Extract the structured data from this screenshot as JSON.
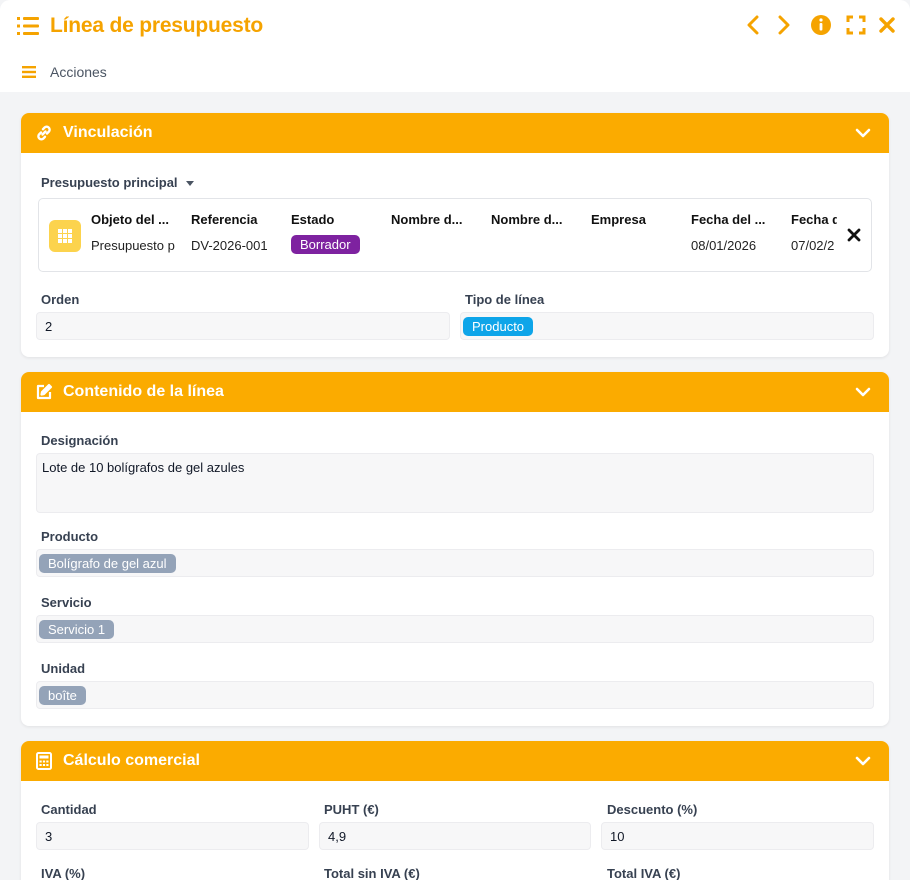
{
  "window": {
    "title": "Línea de presupuesto",
    "actions_label": "Acciones"
  },
  "colors": {
    "accent": "#fbab00",
    "title": "#f5a300",
    "chip_blue": "#0ea5e9",
    "chip_grey": "#94a3b8",
    "chip_purple": "#7e22a0"
  },
  "icons": {
    "title": "list-menu-icon",
    "prev": "chevron-left-icon",
    "next": "chevron-right-icon",
    "info": "info-icon",
    "fullscreen": "fullscreen-icon",
    "close": "close-icon",
    "vinculacion": "link-icon",
    "contenido": "edit-icon",
    "calculo": "calculator-icon"
  },
  "vinculacion": {
    "title": "Vinculación",
    "parent_label": "Presupuesto principal",
    "columns": [
      "Objeto del ...",
      "Referencia",
      "Estado",
      "Nombre d...",
      "Nombre d...",
      "Empresa",
      "Fecha del ...",
      "Fecha d"
    ],
    "row": {
      "objeto": "Presupuesto p",
      "referencia": "DV-2026-001",
      "estado": "Borrador",
      "fecha1": "08/01/2026",
      "fecha2": "07/02/2"
    },
    "orden_label": "Orden",
    "orden_value": "2",
    "tipo_label": "Tipo de línea",
    "tipo_value": "Producto"
  },
  "contenido": {
    "title": "Contenido de la línea",
    "designacion_label": "Designación",
    "designacion_value": "Lote de 10 bolígrafos de gel azules",
    "producto_label": "Producto",
    "producto_value": "Bolígrafo de gel azul",
    "servicio_label": "Servicio",
    "servicio_value": "Servicio 1",
    "unidad_label": "Unidad",
    "unidad_value": "boîte"
  },
  "calculo": {
    "title": "Cálculo comercial",
    "cantidad_label": "Cantidad",
    "cantidad_value": "3",
    "puht_label": "PUHT (€)",
    "puht_value": "4,9",
    "descuento_label": "Descuento (%)",
    "descuento_value": "10",
    "iva_label": "IVA (%)",
    "total_sin_iva_label": "Total sin IVA (€)",
    "total_iva_label": "Total IVA (€)"
  }
}
